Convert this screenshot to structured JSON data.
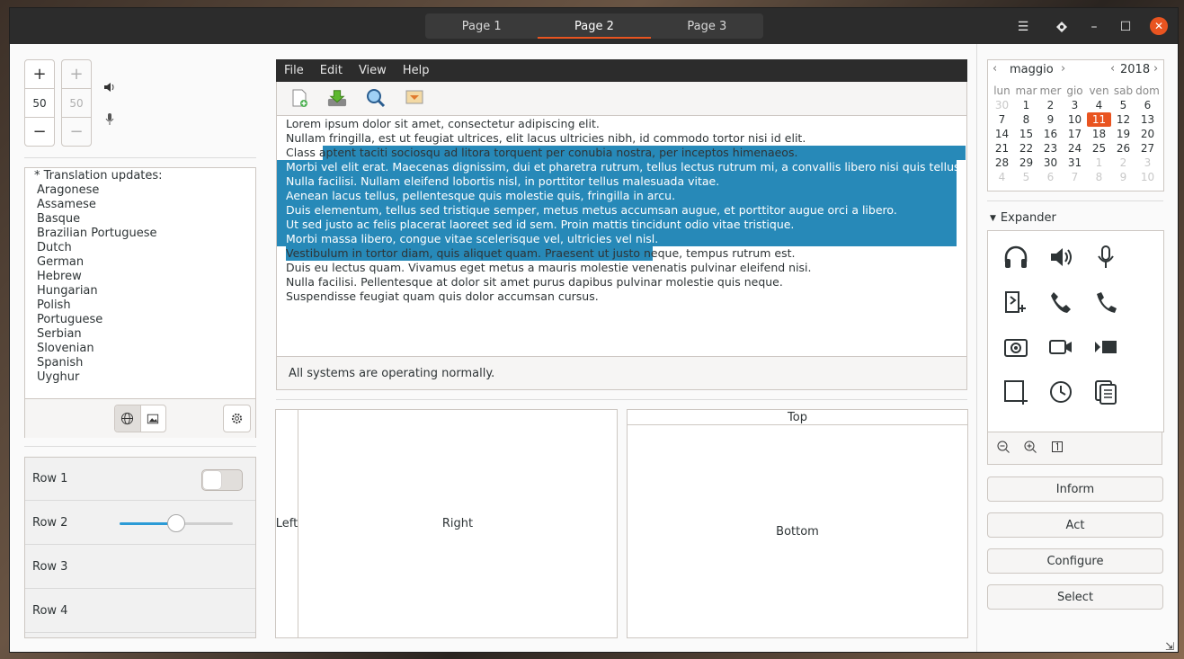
{
  "header": {
    "tabs": [
      "Page 1",
      "Page 2",
      "Page 3"
    ],
    "active_tab": "Page 2"
  },
  "spinners": {
    "left_value": "50",
    "right_value": "50"
  },
  "translations": {
    "title": "* Translation updates:",
    "items": [
      "Aragonese",
      "Assamese",
      "Basque",
      "Brazilian Portuguese",
      "Dutch",
      "German",
      "Hebrew",
      "Hungarian",
      "Polish",
      "Portuguese",
      "Serbian",
      "Slovenian",
      "Spanish",
      "Uyghur"
    ]
  },
  "rows": {
    "r1": "Row 1",
    "r2": "Row 2",
    "r3": "Row 3",
    "r4": "Row 4",
    "slider_fraction": 0.49
  },
  "menu": {
    "file": "File",
    "edit": "Edit",
    "view": "View",
    "help": "Help"
  },
  "text_lines": [
    "Lorem ipsum dolor sit amet, consectetur adipiscing elit.",
    "Nullam fringilla, est ut feugiat ultrices, elit lacus ultricies nibh, id commodo tortor nisi id elit.",
    "Class aptent taciti sociosqu ad litora torquent per conubia nostra, per inceptos himenaeos.",
    "Morbi vel elit erat. Maecenas dignissim, dui et pharetra rutrum, tellus lectus rutrum mi, a convallis libero nisi quis tellus.",
    "Nulla facilisi. Nullam eleifend lobortis nisl, in porttitor tellus malesuada vitae.",
    "Aenean lacus tellus, pellentesque quis molestie quis, fringilla in arcu.",
    "Duis elementum, tellus sed tristique semper, metus metus accumsan augue, et porttitor augue orci a libero.",
    "Ut sed justo ac felis placerat laoreet sed id sem. Proin mattis tincidunt odio vitae tristique.",
    "Morbi massa libero, congue vitae scelerisque vel, ultricies vel nisl.",
    "Vestibulum in tortor diam, quis aliquet quam. Praesent ut justo neque, tempus rutrum est.",
    "Duis eu lectus quam. Vivamus eget metus a mauris molestie venenatis pulvinar eleifend nisi.",
    "Nulla facilisi. Pellentesque at dolor sit amet purus dapibus pulvinar molestie quis neque.",
    "Suspendisse feugiat quam quis dolor accumsan cursus."
  ],
  "status": "All systems are operating normally.",
  "paned": {
    "left": "Left",
    "right": "Right",
    "top": "Top",
    "bottom": "Bottom"
  },
  "calendar": {
    "month": "maggio",
    "year": "2018",
    "weekdays": [
      "lun",
      "mar",
      "mer",
      "gio",
      "ven",
      "sab",
      "dom"
    ],
    "weeks": [
      [
        "30",
        "1",
        "2",
        "3",
        "4",
        "5",
        "6"
      ],
      [
        "7",
        "8",
        "9",
        "10",
        "11",
        "12",
        "13"
      ],
      [
        "14",
        "15",
        "16",
        "17",
        "18",
        "19",
        "20"
      ],
      [
        "21",
        "22",
        "23",
        "24",
        "25",
        "26",
        "27"
      ],
      [
        "28",
        "29",
        "30",
        "31",
        "1",
        "2",
        "3"
      ],
      [
        "4",
        "5",
        "6",
        "7",
        "8",
        "9",
        "10"
      ]
    ],
    "today": "11"
  },
  "expander": {
    "label": "Expander"
  },
  "buttons": {
    "inform": "Inform",
    "act": "Act",
    "configure": "Configure",
    "select": "Select"
  },
  "colors": {
    "accent": "#e95420",
    "selection": "#2789b8",
    "slider": "#2c9bd6"
  }
}
